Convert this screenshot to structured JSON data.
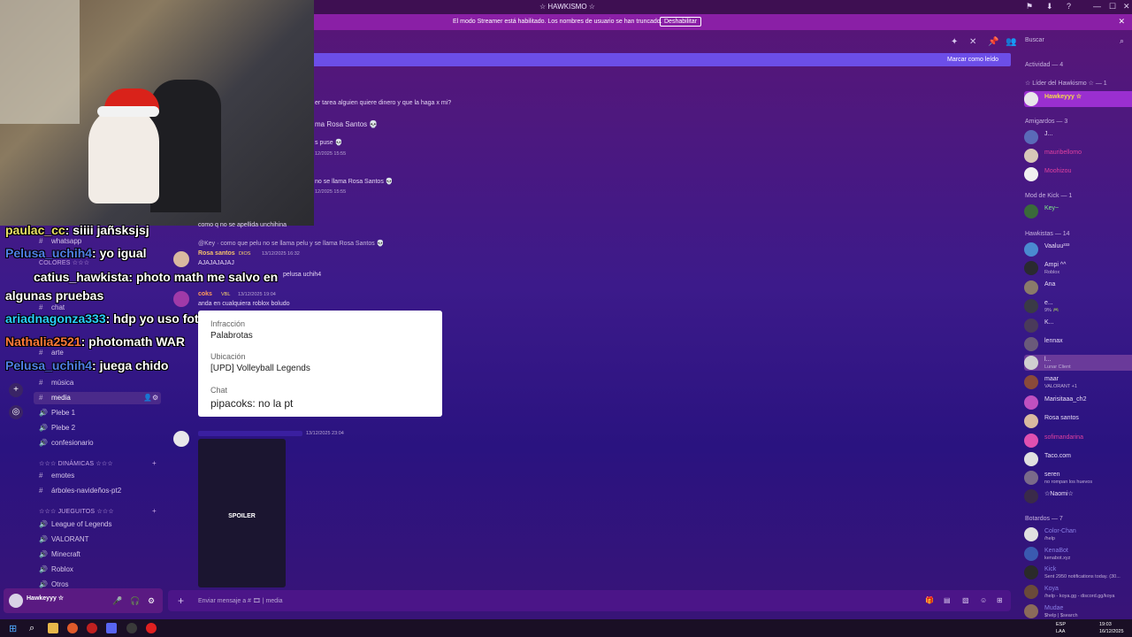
{
  "window": {
    "title": "☆ HAWKISMO ☆"
  },
  "streamer_banner": {
    "text": "El modo Streamer está habilitado. Los nombres de usuario se han truncado.",
    "button": "Deshabilitar"
  },
  "header": {
    "search_placeholder": "Buscar"
  },
  "new_messages": {
    "mark_read": "Marcar como leído"
  },
  "overlay_chat": [
    {
      "user": "paulac_cc",
      "text": ": siiii jañsksjsj",
      "color": "#e8e066"
    },
    {
      "user": "Pelusa_uchih4",
      "text": ": yo igual",
      "color": "#4f7fe6"
    },
    {
      "user": "catius_hawkista",
      "text": ": photo math me salvo en",
      "color": "#ffffff"
    },
    {
      "user": "",
      "text": "algunas pruebas",
      "color": "#ffffff"
    },
    {
      "user": "ariadnagonza333",
      "text": ": hdp yo uso fotomath forro",
      "color": "#2ad0ff"
    },
    {
      "user": "Nathalia2521",
      "text": ": photomath WAR",
      "color": "#ff7a3a"
    },
    {
      "user": "Pelusa_uchih4",
      "text": ": juega chido",
      "color": "#4f7fe6"
    }
  ],
  "channels": {
    "items": [
      {
        "label": "whatsapp",
        "icon": "📱"
      },
      {
        "label": "COLORES ☆☆☆",
        "category": true
      },
      {
        "label": "chat",
        "icon": "💬"
      },
      {
        "label": "arte",
        "icon": "🎨"
      },
      {
        "label": "música",
        "icon": "🎵"
      },
      {
        "label": "media",
        "icon": "🎞"
      },
      {
        "label": "Plebe 1",
        "voice": true
      },
      {
        "label": "Plebe 2",
        "voice": true
      },
      {
        "label": "confesionario",
        "voice": true
      },
      {
        "label": "☆☆☆ DINÁMICAS ☆☆☆",
        "category": true
      },
      {
        "label": "emotes"
      },
      {
        "label": "árboles-navideños-pt2"
      },
      {
        "label": "☆☆☆ JUEGUITOS ☆☆☆",
        "category": true
      },
      {
        "label": "League of Legends",
        "voice": true
      },
      {
        "label": "VALORANT",
        "voice": true
      },
      {
        "label": "Minecraft",
        "voice": true
      },
      {
        "label": "Roblox",
        "voice": true
      },
      {
        "label": "Otros",
        "voice": true
      }
    ]
  },
  "user_panel": {
    "name": "Hawkeyyy ☆"
  },
  "messages": {
    "m1": "er tarea alguien quiere dinero y que la haga x mi?",
    "m2": "ma Rosa Santos 💀",
    "m3": "s puse 💀",
    "m3t": "12/2025 15:55",
    "m4": "no se llama Rosa Santos 💀",
    "m4t": "12/2025 15:55",
    "m5": "como q no se apellida unchihina",
    "reply1": "@Key · como que pelu no se llama pelu y se llama Rosa Santos 💀",
    "rosa_name": "Rosa santos",
    "rosa_badge": "DIOS",
    "rosa_time": "13/12/2025 16:32",
    "rosa_text": "AJAJAJAJAJ",
    "rosa_text2": "pelusa uchih4",
    "coks_name": "coks",
    "coks_badge": "VBL",
    "coks_time": "13/12/2025 19:04",
    "coks_text": "anda en cualquiera roblox boludo",
    "last_time": "13/12/2025 23:04",
    "spoiler": "SPOILER"
  },
  "popup": {
    "infraction_label": "Infracción",
    "infraction_value": "Palabrotas",
    "location_label": "Ubicación",
    "location_value": "[UPD] Volleyball Legends",
    "chat_label": "Chat",
    "chat_value": "pipacoks: no la pt"
  },
  "composer": {
    "placeholder": "Enviar mensaje a # 🎞 | media"
  },
  "members": {
    "activity": "Actividad — 4",
    "leader_head": "☆ Líder del Hawkismo ☆ — 1",
    "leader": [
      {
        "name": "Hawkeyyy ☆",
        "color": "#f5d94a"
      }
    ],
    "friends_head": "Amigardos — 3",
    "friends": [
      {
        "name": "J...",
        "status": "",
        "color": "#e8dcf6"
      },
      {
        "name": "mauribellomo",
        "status": "",
        "color": "#e040a0"
      },
      {
        "name": "Moohizou",
        "status": "",
        "color": "#e040a0"
      }
    ],
    "mods_head": "Mod de Kick — 1",
    "mods": [
      {
        "name": "Key~",
        "status": "",
        "color": "#7ff08a"
      }
    ],
    "hawk_head": "Hawkistas — 14",
    "hawk": [
      {
        "name": "Vaaluu³³³",
        "status": "",
        "color": "#e8dcf6"
      },
      {
        "name": "Ampi ^^",
        "status": "Roblox",
        "color": "#e8dcf6"
      },
      {
        "name": "Ana",
        "status": "",
        "color": "#e8dcf6"
      },
      {
        "name": "e...",
        "status": "9% 🎮",
        "color": "#e8dcf6"
      },
      {
        "name": "K...",
        "status": "",
        "color": "#e8dcf6"
      },
      {
        "name": "lennax",
        "status": "",
        "color": "#e8dcf6"
      },
      {
        "name": "l...",
        "status": "Lunar Client",
        "color": "#e8dcf6"
      },
      {
        "name": "maar",
        "status": "VALORANT +1",
        "color": "#e8dcf6"
      },
      {
        "name": "Marisitaaa_ch2",
        "status": "",
        "color": "#e8dcf6"
      },
      {
        "name": "Rosa santos",
        "status": "",
        "color": "#e8dcf6"
      },
      {
        "name": "sofimandarina",
        "status": "",
        "color": "#e040a0"
      },
      {
        "name": "Taco.com",
        "status": "",
        "color": "#e8dcf6"
      },
      {
        "name": "seren",
        "status": "no rompan los huevos",
        "color": "#e8dcf6"
      },
      {
        "name": "☆Naomi☆",
        "status": "",
        "color": "#e8dcf6"
      }
    ],
    "bots_head": "Botardos — 7",
    "bots": [
      {
        "name": "Color-Chan",
        "status": "/help",
        "color": "#8a7fe6"
      },
      {
        "name": "KenaBot",
        "status": "kenabot.xyz",
        "color": "#8a7fe6"
      },
      {
        "name": "Kick",
        "status": "Sent 2950 notifications today. (30...",
        "color": "#8a7fe6"
      },
      {
        "name": "Koya",
        "status": "/help - koya.gg - discord.gg/koya",
        "color": "#8a7fe6"
      },
      {
        "name": "Mudae",
        "status": "$help | $search",
        "color": "#8a7fe6"
      }
    ],
    "app_badge": "✓ APP"
  },
  "taskbar": {
    "lang": "ESP",
    "lang2": "LAA",
    "time": "19:03",
    "date": "16/12/2025"
  }
}
